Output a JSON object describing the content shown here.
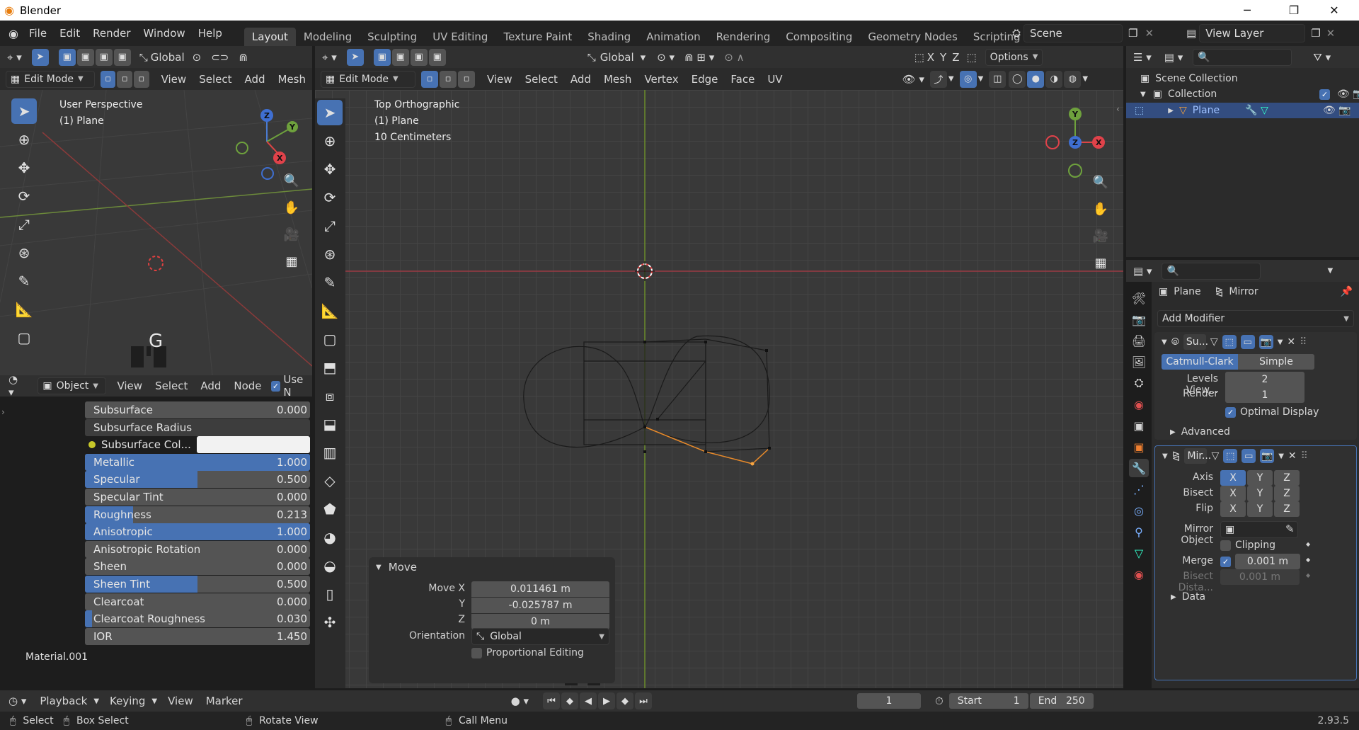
{
  "window": {
    "title": "Blender",
    "minimize": "─",
    "maximize": "❐",
    "close": "✕"
  },
  "menu": [
    "File",
    "Edit",
    "Render",
    "Window",
    "Help"
  ],
  "workspaces": [
    "Layout",
    "Modeling",
    "Sculpting",
    "UV Editing",
    "Texture Paint",
    "Shading",
    "Animation",
    "Rendering",
    "Compositing",
    "Geometry Nodes",
    "Scripting"
  ],
  "active_workspace": "Layout",
  "scene": "Scene",
  "view_layer": "View Layer",
  "left_viewport": {
    "orientation": "Global",
    "mode": "Edit Mode",
    "menus": [
      "View",
      "Select",
      "Add",
      "Mesh"
    ],
    "overlay_title": "User Perspective",
    "overlay_object": "(1) Plane",
    "key_display": "G"
  },
  "main_viewport": {
    "orientation": "Global",
    "mode": "Edit Mode",
    "menus": [
      "View",
      "Select",
      "Add",
      "Mesh",
      "Vertex",
      "Edge",
      "Face",
      "UV"
    ],
    "options": "Options",
    "axes": [
      "X",
      "Y",
      "Z"
    ],
    "overlay_title": "Top Orthographic",
    "overlay_object": "(1) Plane",
    "overlay_scale": "10 Centimeters"
  },
  "gizmo": {
    "x": "X",
    "y": "Y",
    "z": "Z"
  },
  "move_panel": {
    "title": "Move",
    "labels": {
      "x": "Move X",
      "y": "Y",
      "z": "Z",
      "orientation": "Orientation"
    },
    "x": "0.011461 m",
    "y": "-0.025787 m",
    "z": "0 m",
    "orientation": "Global",
    "proportional": "Proportional Editing"
  },
  "node_editor": {
    "header": {
      "object": "Object",
      "menus": [
        "View",
        "Select",
        "Add",
        "Node"
      ],
      "use_nodes": "Use N"
    },
    "material_label": "Material.001",
    "rows": [
      {
        "label": "Subsurface",
        "value": "0.000",
        "fill": 0
      },
      {
        "label": "Subsurface Radius",
        "value": "",
        "fill": 0
      },
      {
        "label": "Subsurface Col...",
        "value": "",
        "fill": 0
      },
      {
        "label": "Metallic",
        "value": "1.000",
        "fill": 1
      },
      {
        "label": "Specular",
        "value": "0.500",
        "fill": 0.5
      },
      {
        "label": "Specular Tint",
        "value": "0.000",
        "fill": 0
      },
      {
        "label": "Roughness",
        "value": "0.213",
        "fill": 0.213
      },
      {
        "label": "Anisotropic",
        "value": "1.000",
        "fill": 1
      },
      {
        "label": "Anisotropic Rotation",
        "value": "0.000",
        "fill": 0
      },
      {
        "label": "Sheen",
        "value": "0.000",
        "fill": 0
      },
      {
        "label": "Sheen Tint",
        "value": "0.500",
        "fill": 0.5
      },
      {
        "label": "Clearcoat",
        "value": "0.000",
        "fill": 0
      },
      {
        "label": "Clearcoat Roughness",
        "value": "0.030",
        "fill": 0.03
      },
      {
        "label": "IOR",
        "value": "1.450",
        "fill": 0
      }
    ]
  },
  "outliner": {
    "scene_collection": "Scene Collection",
    "collection": "Collection",
    "object": "Plane"
  },
  "properties": {
    "object": "Plane",
    "modifier_tab": "Mirror",
    "add_modifier": "Add Modifier",
    "subsurf": {
      "name": "Su...",
      "catmull": "Catmull-Clark",
      "simple": "Simple",
      "levels_label": "Levels View...",
      "levels": "2",
      "render_label": "Render",
      "render": "1",
      "optimal": "Optimal Display",
      "advanced": "Advanced"
    },
    "mirror": {
      "name": "Mir...",
      "axis_label": "Axis",
      "bisect_label": "Bisect",
      "flip_label": "Flip",
      "axes": [
        "X",
        "Y",
        "Z"
      ],
      "mirror_object_label": "Mirror Object",
      "clipping": "Clipping",
      "merge_label": "Merge",
      "merge": "0.001 m",
      "bisect_dist_label": "Bisect Dista...",
      "bisect_dist": "0.001 m",
      "data": "Data"
    }
  },
  "timeline": {
    "menus": [
      "Playback",
      "Keying",
      "View",
      "Marker"
    ],
    "current_frame": "1",
    "start_label": "Start",
    "start": "1",
    "end_label": "End",
    "end": "250"
  },
  "statusbar": {
    "select": "Select",
    "box_select": "Box Select",
    "rotate": "Rotate View",
    "call_menu": "Call Menu",
    "version": "2.93.5"
  }
}
